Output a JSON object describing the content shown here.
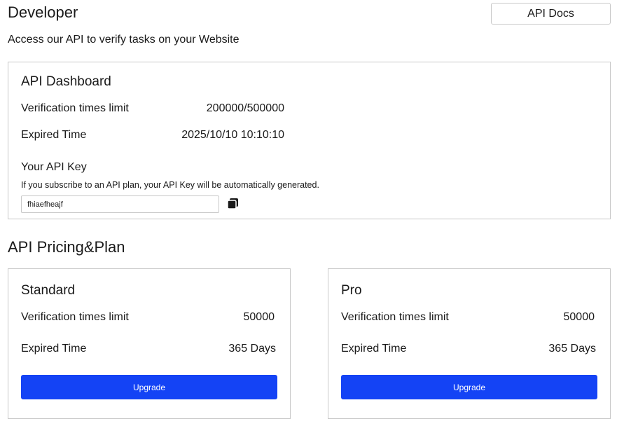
{
  "header": {
    "title": "Developer",
    "api_docs_label": "API Docs",
    "subtitle": "Access our API to verify tasks on your Website"
  },
  "dashboard": {
    "title": "API Dashboard",
    "verification_label": "Verification times limit",
    "verification_value": "200000/500000",
    "expired_label": "Expired Time",
    "expired_value": "2025/10/10 10:10:10",
    "key_title": "Your API Key",
    "key_note": "If you subscribe to an API plan, your API Key will be automatically generated.",
    "api_key_value": "fhiaefheajf",
    "copy_icon": "copy-icon"
  },
  "pricing": {
    "title": "API Pricing&Plan",
    "plans": [
      {
        "name": "Standard",
        "verification_label": "Verification times limit",
        "verification_value": "50000",
        "expired_label": "Expired Time",
        "expired_value": "365 Days",
        "button_label": "Upgrade"
      },
      {
        "name": "Pro",
        "verification_label": "Verification times limit",
        "verification_value": "50000",
        "expired_label": "Expired Time",
        "expired_value": "365 Days",
        "button_label": "Upgrade"
      }
    ]
  },
  "colors": {
    "accent": "#1443f5",
    "border": "#c8c8c8",
    "text": "#1a1a1a"
  }
}
